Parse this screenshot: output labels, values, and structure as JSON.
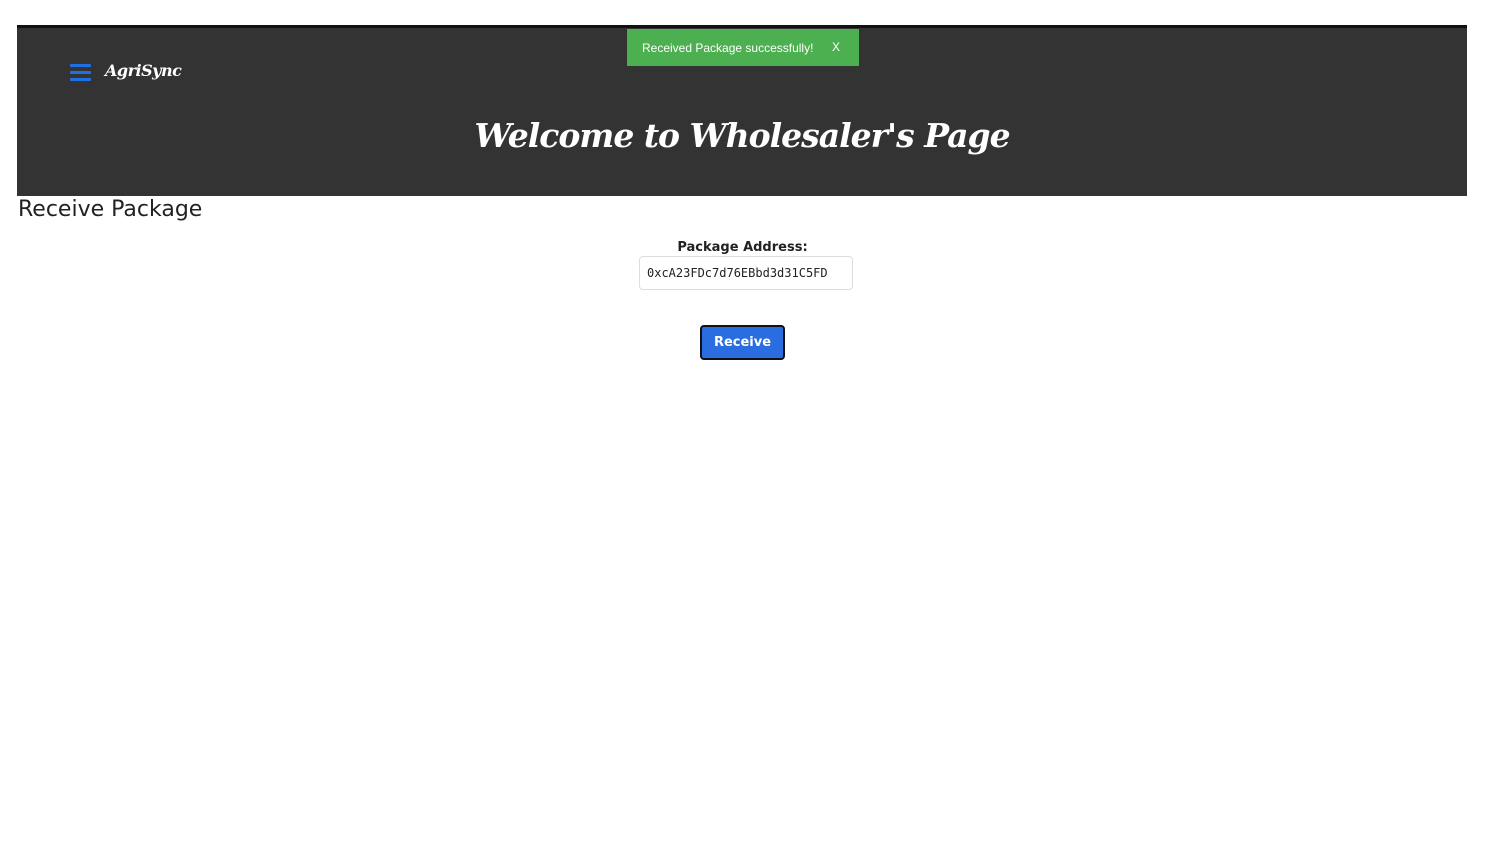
{
  "header": {
    "brand": "AgriSync",
    "title": "Welcome to Wholesaler's Page",
    "menu_icon": "hamburger-menu-icon",
    "background_color": "#333333",
    "menu_icon_color": "#1f6fe5"
  },
  "toast": {
    "message": "Received Package successfully!",
    "close_label": "X",
    "background_color": "#4caf50"
  },
  "main": {
    "section_title": "Receive Package",
    "address_label": "Package Address:",
    "address_value": "0xcA23FDc7d76EBbd3d31C5FD",
    "receive_label": "Receive",
    "button_color": "#2a6de0"
  }
}
